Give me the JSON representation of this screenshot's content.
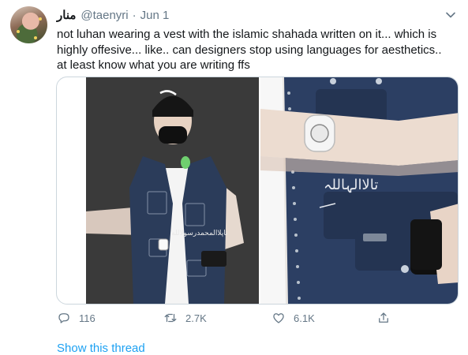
{
  "tweet": {
    "display_name": "منار",
    "handle": "@taenyri",
    "separator": "·",
    "date": "Jun 1",
    "text": "not luhan wearing a vest with the islamic shahada written on it... which is\nhighly offesive... like.. can designers stop using languages for aesthetics..\nat least know what you are writing ffs"
  },
  "actions": {
    "reply_count": "116",
    "retweet_count": "2.7K",
    "like_count": "6.1K"
  },
  "show_thread": "Show this thread",
  "colors": {
    "link": "#1da1f2",
    "muted": "#657786",
    "text": "#14171a"
  }
}
